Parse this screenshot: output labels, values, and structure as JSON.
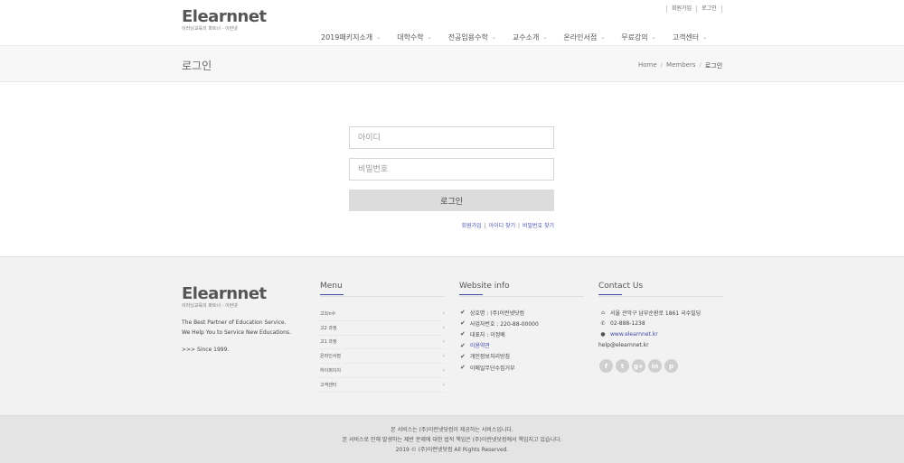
{
  "header": {
    "logo_text": "Elearnnet",
    "logo_sub": "이러닝교육의 파트너 - 이런넷",
    "top_links": [
      "회원가입",
      "로그인"
    ],
    "nav": [
      "2019패키지소개",
      "대학수학",
      "전공임용수학",
      "교수소개",
      "온라인서점",
      "무료강의",
      "고객센터"
    ]
  },
  "titlebar": {
    "title": "로그인",
    "breadcrumb": [
      "Home",
      "Members",
      "로그인"
    ]
  },
  "login": {
    "id_placeholder": "아이디",
    "pw_placeholder": "비밀번호",
    "button": "로그인",
    "links": [
      "회원가입",
      "아이디 찾기",
      "비밀번호 찾기"
    ]
  },
  "footer": {
    "logo_text": "Elearnnet",
    "logo_sub": "이러닝교육의 파트너 - 이런넷",
    "desc_line1": "The Best Partner of Education Service.",
    "desc_line2": "We Help You to Service New Educations.",
    "since": ">>> Since 1999.",
    "menu_title": "Menu",
    "menu_items": [
      "고3/n수",
      "고2 과정",
      "고1 과정",
      "온라인서점",
      "하이퍼이치",
      "고객센터"
    ],
    "info_title": "Website info",
    "info_items": [
      "상호명 : (주)이런넷닷컴",
      "사업자번호 : 220-88-00000",
      "대표자 : 이정배",
      "이용약관",
      "개인정보처리방침",
      "이메일무단수집거부"
    ],
    "contact_title": "Contact Us",
    "contact_address": "서울 관악구 남부순환로 1861 국수빌딩",
    "contact_phone": "02-888-1238",
    "contact_web": "www.elearnnet.kr",
    "contact_email": "help@elearnnet.kr",
    "social": [
      "f",
      "t",
      "g+",
      "in",
      "p"
    ]
  },
  "copyright": {
    "line1": "본 서비스는 (주)이런넷닷컴이 제공하는 서비스입니다.",
    "line2": "본 서비스로 인해 발생하는 제반 문제에 대한 법적 책임은 (주)이런넷닷컴에서 책임지고 있습니다.",
    "line3": "2019 © (주)이런넷닷컴 All Rights Reserved."
  }
}
